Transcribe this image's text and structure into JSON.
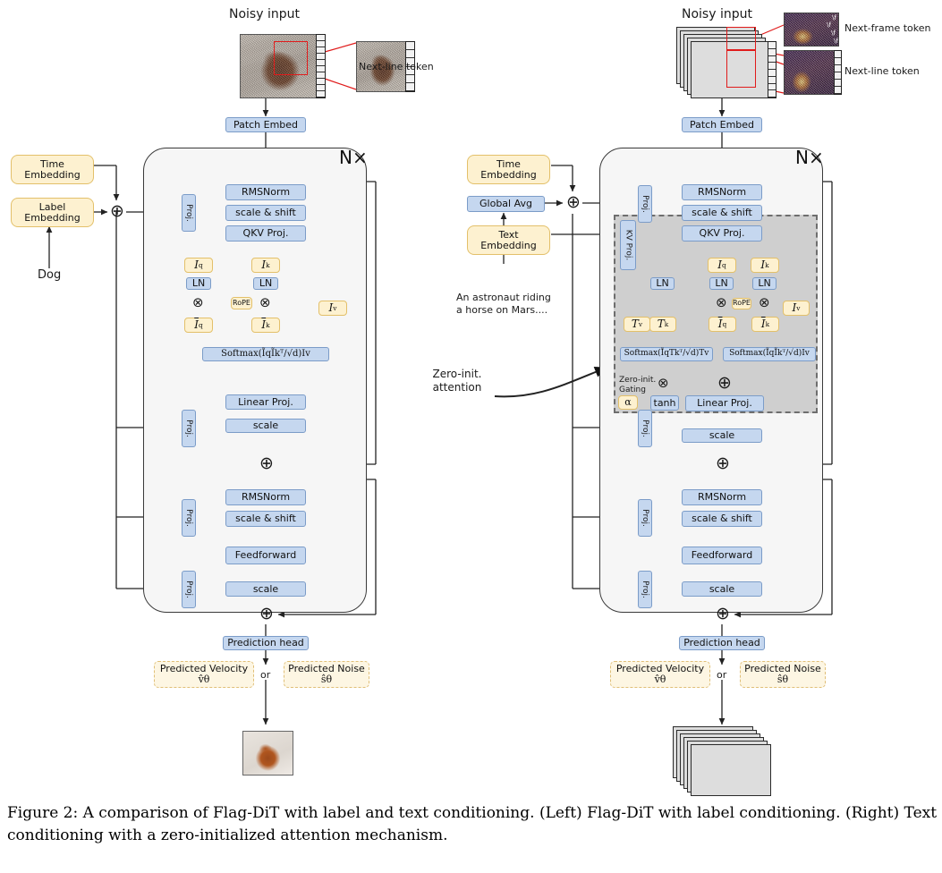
{
  "caption": "Figure 2: A comparison of Flag-DiT with label and text conditioning. (Left) Flag-DiT with label conditioning. (Right) Text conditioning with a zero-initialized attention mechanism.",
  "common": {
    "noisy_input": "Noisy input",
    "patch_embed": "Patch Embed",
    "nx": "N×",
    "rmsnorm": "RMSNorm",
    "scale_shift": "scale & shift",
    "qkv_proj": "QKV Proj.",
    "ln": "LN",
    "rope": "RoPE",
    "linear_proj": "Linear Proj.",
    "scale": "scale",
    "feedforward": "Feedforward",
    "proj": "Proj.",
    "prediction_head": "Prediction head",
    "predicted_velocity": "Predicted Velocity",
    "velocity_symbol": "v̂θ",
    "or": "or",
    "predicted_noise": "Predicted Noise",
    "noise_symbol": "ŝθ",
    "time_embedding": "Time Embedding",
    "plus_icon": "⊕",
    "times_icon": "⊗",
    "next_line_token": "Next-line token",
    "token_glyph_line": "\\n"
  },
  "left": {
    "label_embedding": "Label Embedding",
    "prompt": "Dog",
    "tokens": {
      "Iq": "I",
      "Iq_sub": "q",
      "Ik": "I",
      "Ik_sub": "k",
      "Iv": "I",
      "Iv_sub": "v",
      "Iq_tilde": "Ĩ",
      "Ik_tilde": "Ĩ"
    },
    "softmax": "Softmax(ĨqĨkᵀ/√d)Iv"
  },
  "right": {
    "global_avg": "Global Avg",
    "text_embedding": "Text Embedding",
    "prompt": "An astronaut riding a horse on Mars....",
    "kv_proj": "KV Proj.",
    "zero_init_attention": "Zero-init. attention",
    "zero_init_gating": "Zero-init. Gating",
    "alpha": "α",
    "tanh": "tanh",
    "next_frame_token": "Next-frame token",
    "token_glyph_frame": "\\f",
    "tokens": {
      "Tv": "T",
      "Tv_sub": "v",
      "Tk": "T",
      "Tk_sub": "k"
    },
    "softmax_text": "Softmax(ĨqTkᵀ/√d)Tv",
    "softmax_image": "Softmax(ĨqĨkᵀ/√d)Iv"
  },
  "colors": {
    "blue_fill": "#c5d7ef",
    "blue_border": "#7b9cc8",
    "yellow_fill": "#fdf1d0",
    "yellow_border": "#e3c06a",
    "block_fill": "#f6f6f6",
    "zero_init_fill": "#cfcfcf",
    "accent_red": "#e01b1b"
  }
}
